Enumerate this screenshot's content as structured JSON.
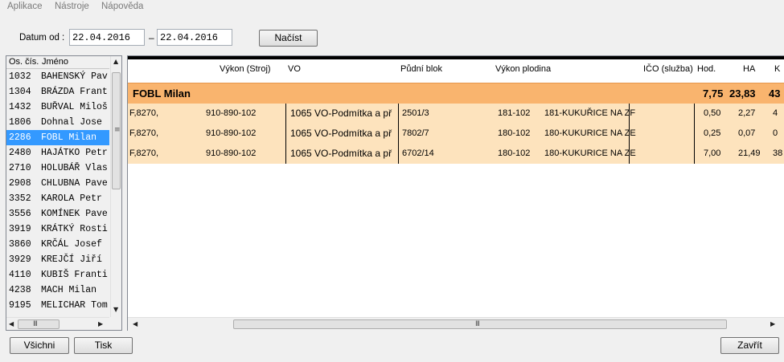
{
  "menu": [
    "Aplikace",
    "Nástroje",
    "Nápověda"
  ],
  "filter": {
    "label": "Datum od :",
    "date_from": "22.04.2016",
    "separator": "–",
    "date_to": "22.04.2016",
    "load_label": "Načíst"
  },
  "employees": {
    "headers": [
      "Os. čís.",
      "Jméno"
    ],
    "rows": [
      {
        "num": "1032",
        "name": "BAHENSKÝ Pav"
      },
      {
        "num": "1304",
        "name": "BRÁZDA Frant"
      },
      {
        "num": "1432",
        "name": "BUŘVAL Miloš"
      },
      {
        "num": "1806",
        "name": "Dohnal  Jose"
      },
      {
        "num": "2286",
        "name": "FOBL Milan"
      },
      {
        "num": "2480",
        "name": "HAJÁTKO Petr"
      },
      {
        "num": "2710",
        "name": "HOLUBÁŘ Vlas"
      },
      {
        "num": "2908",
        "name": "CHLUBNA Pave"
      },
      {
        "num": "3352",
        "name": "KAROLA Petr"
      },
      {
        "num": "3556",
        "name": "KOMÍNEK Pave"
      },
      {
        "num": "3919",
        "name": "KRÁTKÝ Rosti"
      },
      {
        "num": "3860",
        "name": "KRČÁL Josef"
      },
      {
        "num": "3929",
        "name": "KREJČÍ Jiří"
      },
      {
        "num": "4110",
        "name": "KUBIŠ Franti"
      },
      {
        "num": "4238",
        "name": "MACH Milan"
      },
      {
        "num": "9195",
        "name": "MELICHAR Tom"
      }
    ],
    "selected_index": 4
  },
  "grid": {
    "columns": [
      "Výkon (Stroj)",
      "VO",
      "Půdní blok",
      "Výkon plodina",
      "IČO (služba)",
      "Hod.",
      "HA",
      "K"
    ],
    "group": {
      "name": "FOBL Milan",
      "hod": "7,75",
      "ha": "23,83",
      "k": "43"
    },
    "rows": [
      {
        "code": "F,8270,",
        "stroj": "910-890-102",
        "vo": "1065  VO-Podmítka a př",
        "blok": "2501/3",
        "plodina_code": "181-102",
        "plodina": "181-KUKUŘICE NA ZF",
        "hod": "0,50",
        "ha": "2,27",
        "k": "4"
      },
      {
        "code": "F,8270,",
        "stroj": "910-890-102",
        "vo": "1065  VO-Podmítka a př",
        "blok": "7802/7",
        "plodina_code": "180-102",
        "plodina": "180-KUKURICE NA ZE",
        "hod": "0,25",
        "ha": "0,07",
        "k": "0"
      },
      {
        "code": "F,8270,",
        "stroj": "910-890-102",
        "vo": "1065  VO-Podmítka a př",
        "blok": "6702/14",
        "plodina_code": "180-102",
        "plodina": "180-KUKURICE NA ZE",
        "hod": "7,00",
        "ha": "21,49",
        "k": "38"
      }
    ]
  },
  "buttons": {
    "all": "Všichni",
    "print": "Tisk",
    "close": "Zavřít"
  },
  "colors": {
    "group_row": "#f9b46e",
    "data_row": "#fde3bd",
    "selection": "#3399ff"
  }
}
